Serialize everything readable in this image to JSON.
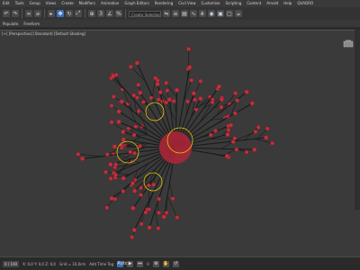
{
  "menu": [
    "Edit",
    "Tools",
    "Group",
    "Views",
    "Create",
    "Modifiers",
    "Animation",
    "Graph Editors",
    "Rendering",
    "Civil View",
    "Customize",
    "Scripting",
    "Content",
    "Arnold",
    "Help",
    "QUADRO"
  ],
  "toolbar": {
    "selection_set": "Create Selection Se"
  },
  "ribbon": {
    "tabs": [
      "Populate",
      "Freeform",
      "Selection",
      "Object Paint",
      "Populate"
    ]
  },
  "viewport": {
    "label": "[+] [Perspective] [Standard] [Default Shading]"
  },
  "status": {
    "timeline_label": "0 / 100",
    "coords": "X: 0,0   Y: 0,0   Z: 0,0",
    "grid": "Grid = 10,0cm",
    "add_time_tag": "Add Time Tag",
    "auto_key": "Auto",
    "frame": "0"
  },
  "icons": {
    "undo": "undo-icon",
    "redo": "redo-icon",
    "link": "link-icon",
    "select": "select-icon",
    "move": "move-icon",
    "rotate": "rotate-icon",
    "scale": "scale-icon",
    "snap": "snap-icon",
    "render": "render-icon"
  },
  "colors": {
    "branch": "#1a1a1a",
    "ball": "#c0303d",
    "helper": "#e6c800",
    "active": "#3b6fb6"
  }
}
